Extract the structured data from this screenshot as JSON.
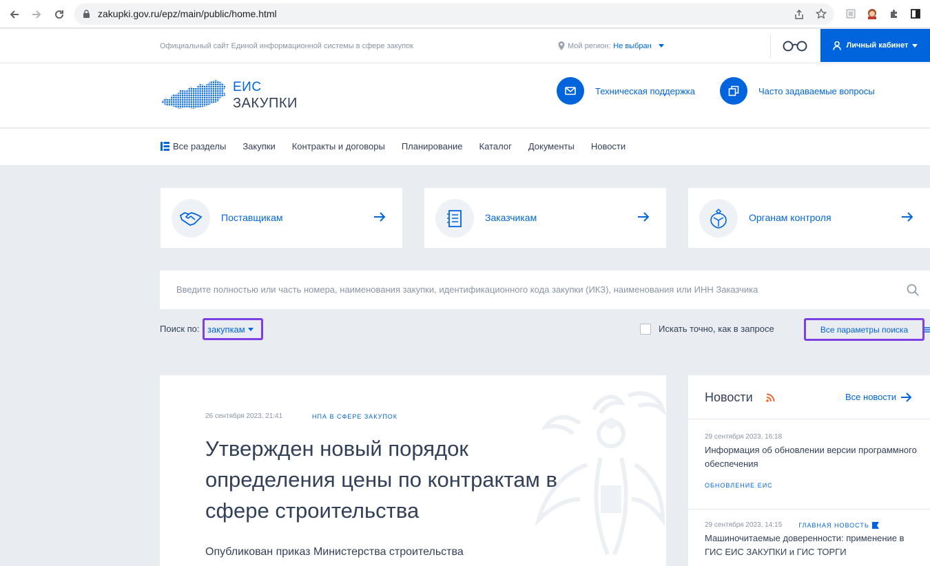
{
  "browser": {
    "url": "zakupki.gov.ru/epz/main/public/home.html"
  },
  "top_strip": {
    "site_description": "Официальный сайт Единой информационной системы в сфере закупок",
    "region_label": "Мой регион:",
    "region_value": "Не выбран",
    "cabinet_label": "Личный кабинет"
  },
  "header": {
    "logo_line1": "ЕИС",
    "logo_line2": "ЗАКУПКИ",
    "support_label": "Техническая поддержка",
    "faq_label": "Часто задаваемые вопросы"
  },
  "menu": {
    "items": [
      "Все разделы",
      "Закупки",
      "Контракты и договоры",
      "Планирование",
      "Каталог",
      "Документы",
      "Новости"
    ]
  },
  "cards": [
    {
      "label": "Поставщикам",
      "icon": "handshake-icon"
    },
    {
      "label": "Заказчикам",
      "icon": "document-icon"
    },
    {
      "label": "Органам контроля",
      "icon": "emblem-icon"
    }
  ],
  "search": {
    "placeholder": "Введите полностью или часть номера, наименования закупки, идентификационного кода закупки (ИКЗ), наименования или ИНН Заказчика",
    "search_by_label": "Поиск по:",
    "search_by_value": "закупкам",
    "exact_label": "Искать точно, как в запросе",
    "all_params_label": "Все параметры поиска"
  },
  "main_news": {
    "date": "26 сентября 2023, 21:41",
    "category": "НПА В СФЕРЕ ЗАКУПОК",
    "title": "Утвержден новый порядок определения цены по контрактам в сфере строительства",
    "lead": "Опубликован приказ Министерства строительства"
  },
  "news_panel": {
    "title": "Новости",
    "all_news_label": "Все новости",
    "items": [
      {
        "date": "29 сентября 2023, 16:18",
        "text": "Информация об обновлении версии программного обеспечения",
        "category": "ОБНОВЛЕНИЕ ЕИС"
      },
      {
        "date": "29 сентября 2023, 14:15",
        "badge": "ГЛАВНАЯ НОВОСТЬ",
        "text": "Машиночитаемые доверенности: применение в ГИС ЕИС ЗАКУПКИ и ГИС ТОРГИ"
      }
    ]
  },
  "colors": {
    "accent": "#0065dd",
    "highlight": "#7b3fe4",
    "text": "#334059",
    "muted": "#8a94a6",
    "background": "#e9ecf1"
  }
}
